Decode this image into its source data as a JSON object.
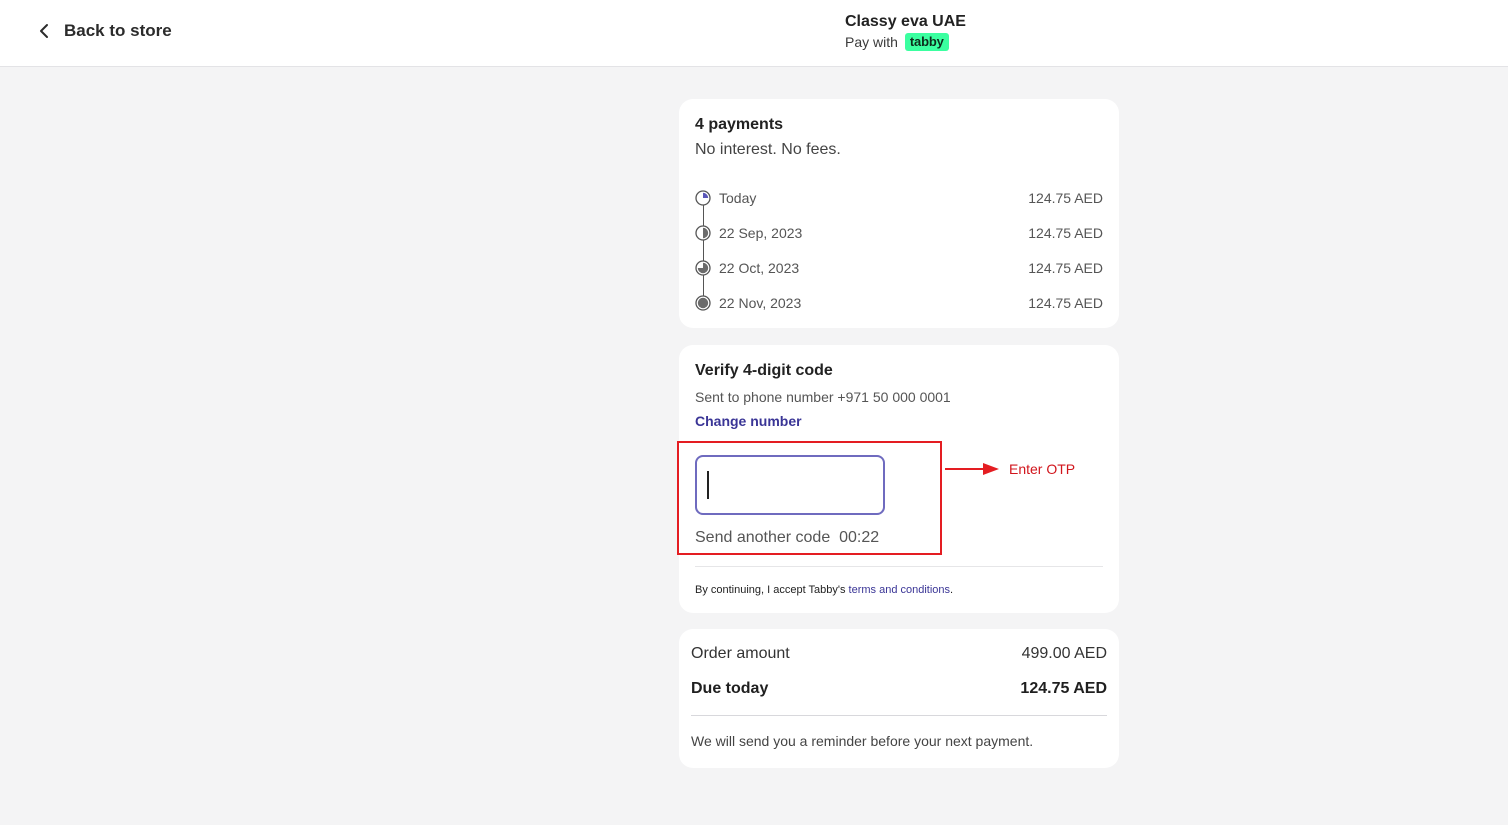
{
  "header": {
    "back_label": "Back to store",
    "merchant_name": "Classy eva UAE",
    "pay_with": "Pay with",
    "brand_logo_text": "tabby",
    "brand_color": "#3bffa0"
  },
  "payments": {
    "title": "4 payments",
    "subtitle": "No interest. No fees.",
    "installments": [
      {
        "date": "Today",
        "amount": "124.75 AED",
        "portion": 0.25
      },
      {
        "date": "22 Sep, 2023",
        "amount": "124.75 AED",
        "portion": 0.5
      },
      {
        "date": "22 Oct, 2023",
        "amount": "124.75 AED",
        "portion": 0.75
      },
      {
        "date": "22 Nov, 2023",
        "amount": "124.75 AED",
        "portion": 1.0
      }
    ]
  },
  "verify": {
    "title": "Verify 4-digit code",
    "sent_to": "Sent to phone number +971 50 000 0001",
    "change_number": "Change number",
    "otp_value": "",
    "resend_label": "Send another code",
    "resend_timer": "00:22",
    "terms_prefix": "By continuing, I accept Tabby's ",
    "terms_link": "terms and conditions",
    "terms_suffix": "."
  },
  "annotation": {
    "label": "Enter OTP",
    "color": "#e41d22"
  },
  "summary": {
    "order_label": "Order amount",
    "order_value": "499.00 AED",
    "due_label": "Due today",
    "due_value": "124.75 AED",
    "reminder": "We will send you a reminder before your next payment."
  }
}
